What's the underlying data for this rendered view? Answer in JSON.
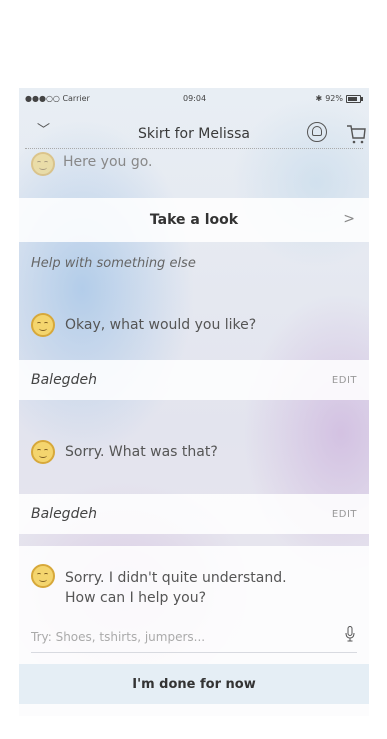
{
  "status_bar": {
    "carrier": "●●●○○ Carrier",
    "time": "09:04",
    "battery": "92%",
    "bluetooth": "✱"
  },
  "header": {
    "title": "Skirt for Melissa",
    "back_icon": "chevron-down-icon",
    "notification_icon": "bell-icon",
    "cart_icon": "cart-icon"
  },
  "chat": {
    "top_message": "Here you go.",
    "take_a_look": "Take a look",
    "help_option": "Help with something else",
    "bot_message_1": "Okay, what would you like?",
    "user_message_1": "Balegdeh",
    "edit_1": "EDIT",
    "bot_message_2": "Sorry. What was that?",
    "user_message_2": "Balegdeh",
    "edit_2": "EDIT",
    "bot_message_3_line1": "Sorry. I didn't quite understand.",
    "bot_message_3_line2": "How can I help you?"
  },
  "input": {
    "placeholder": "Try: Shoes, tshirts, jumpers...",
    "value": ""
  },
  "done_button": "I'm done for now"
}
